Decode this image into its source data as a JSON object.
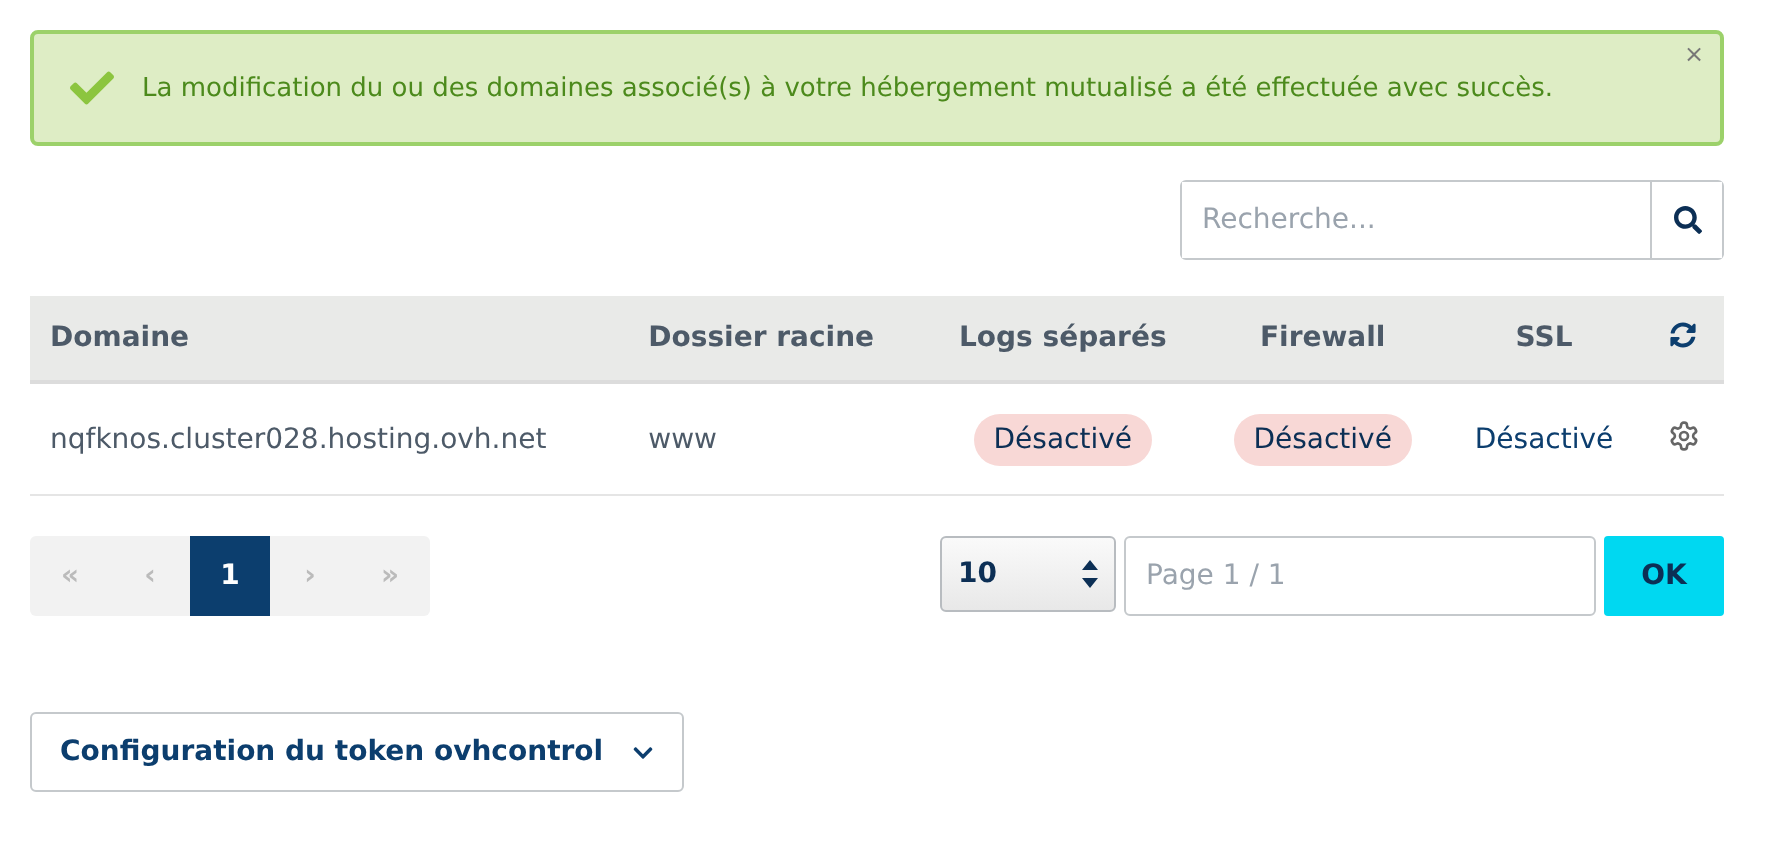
{
  "alert": {
    "message": "La modification du ou des domaines associé(s) à votre hébergement mutualisé a été effectuée avec succès.",
    "close": "×"
  },
  "search": {
    "placeholder": "Recherche..."
  },
  "table": {
    "columns": [
      "Domaine",
      "Dossier racine",
      "Logs séparés",
      "Firewall",
      "SSL"
    ],
    "rows": [
      {
        "cells": [
          {
            "kind": "text",
            "text": "nqfknos.cluster028.hosting.ovh.net"
          },
          {
            "kind": "text",
            "text": "www"
          },
          {
            "kind": "badge",
            "text": "Désactivé"
          },
          {
            "kind": "badge",
            "text": "Désactivé"
          },
          {
            "kind": "link",
            "text": "Désactivé"
          }
        ]
      }
    ]
  },
  "pagination": {
    "items": [
      {
        "label": "«",
        "selected": false,
        "disabled": true
      },
      {
        "label": "‹",
        "selected": false,
        "disabled": true
      },
      {
        "label": "1",
        "selected": true,
        "disabled": false
      },
      {
        "label": "›",
        "selected": false,
        "disabled": true
      },
      {
        "label": "»",
        "selected": false,
        "disabled": true
      }
    ],
    "page_size": "10",
    "page_placeholder": "Page 1 / 1",
    "ok": "OK"
  },
  "config_button": "Configuration du token ovhcontrol"
}
